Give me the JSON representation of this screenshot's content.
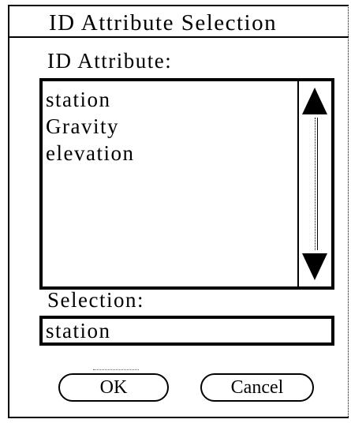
{
  "dialog": {
    "title": "ID Attribute Selection"
  },
  "id_attribute": {
    "label": "ID Attribute:",
    "items": [
      "station",
      "Gravity",
      "elevation"
    ]
  },
  "selection": {
    "label": "Selection:",
    "value": "station"
  },
  "buttons": {
    "ok_label": "OK",
    "cancel_label": "Cancel"
  },
  "icons": {
    "scroll_up": "up-arrow-icon",
    "scroll_down": "down-arrow-icon"
  }
}
